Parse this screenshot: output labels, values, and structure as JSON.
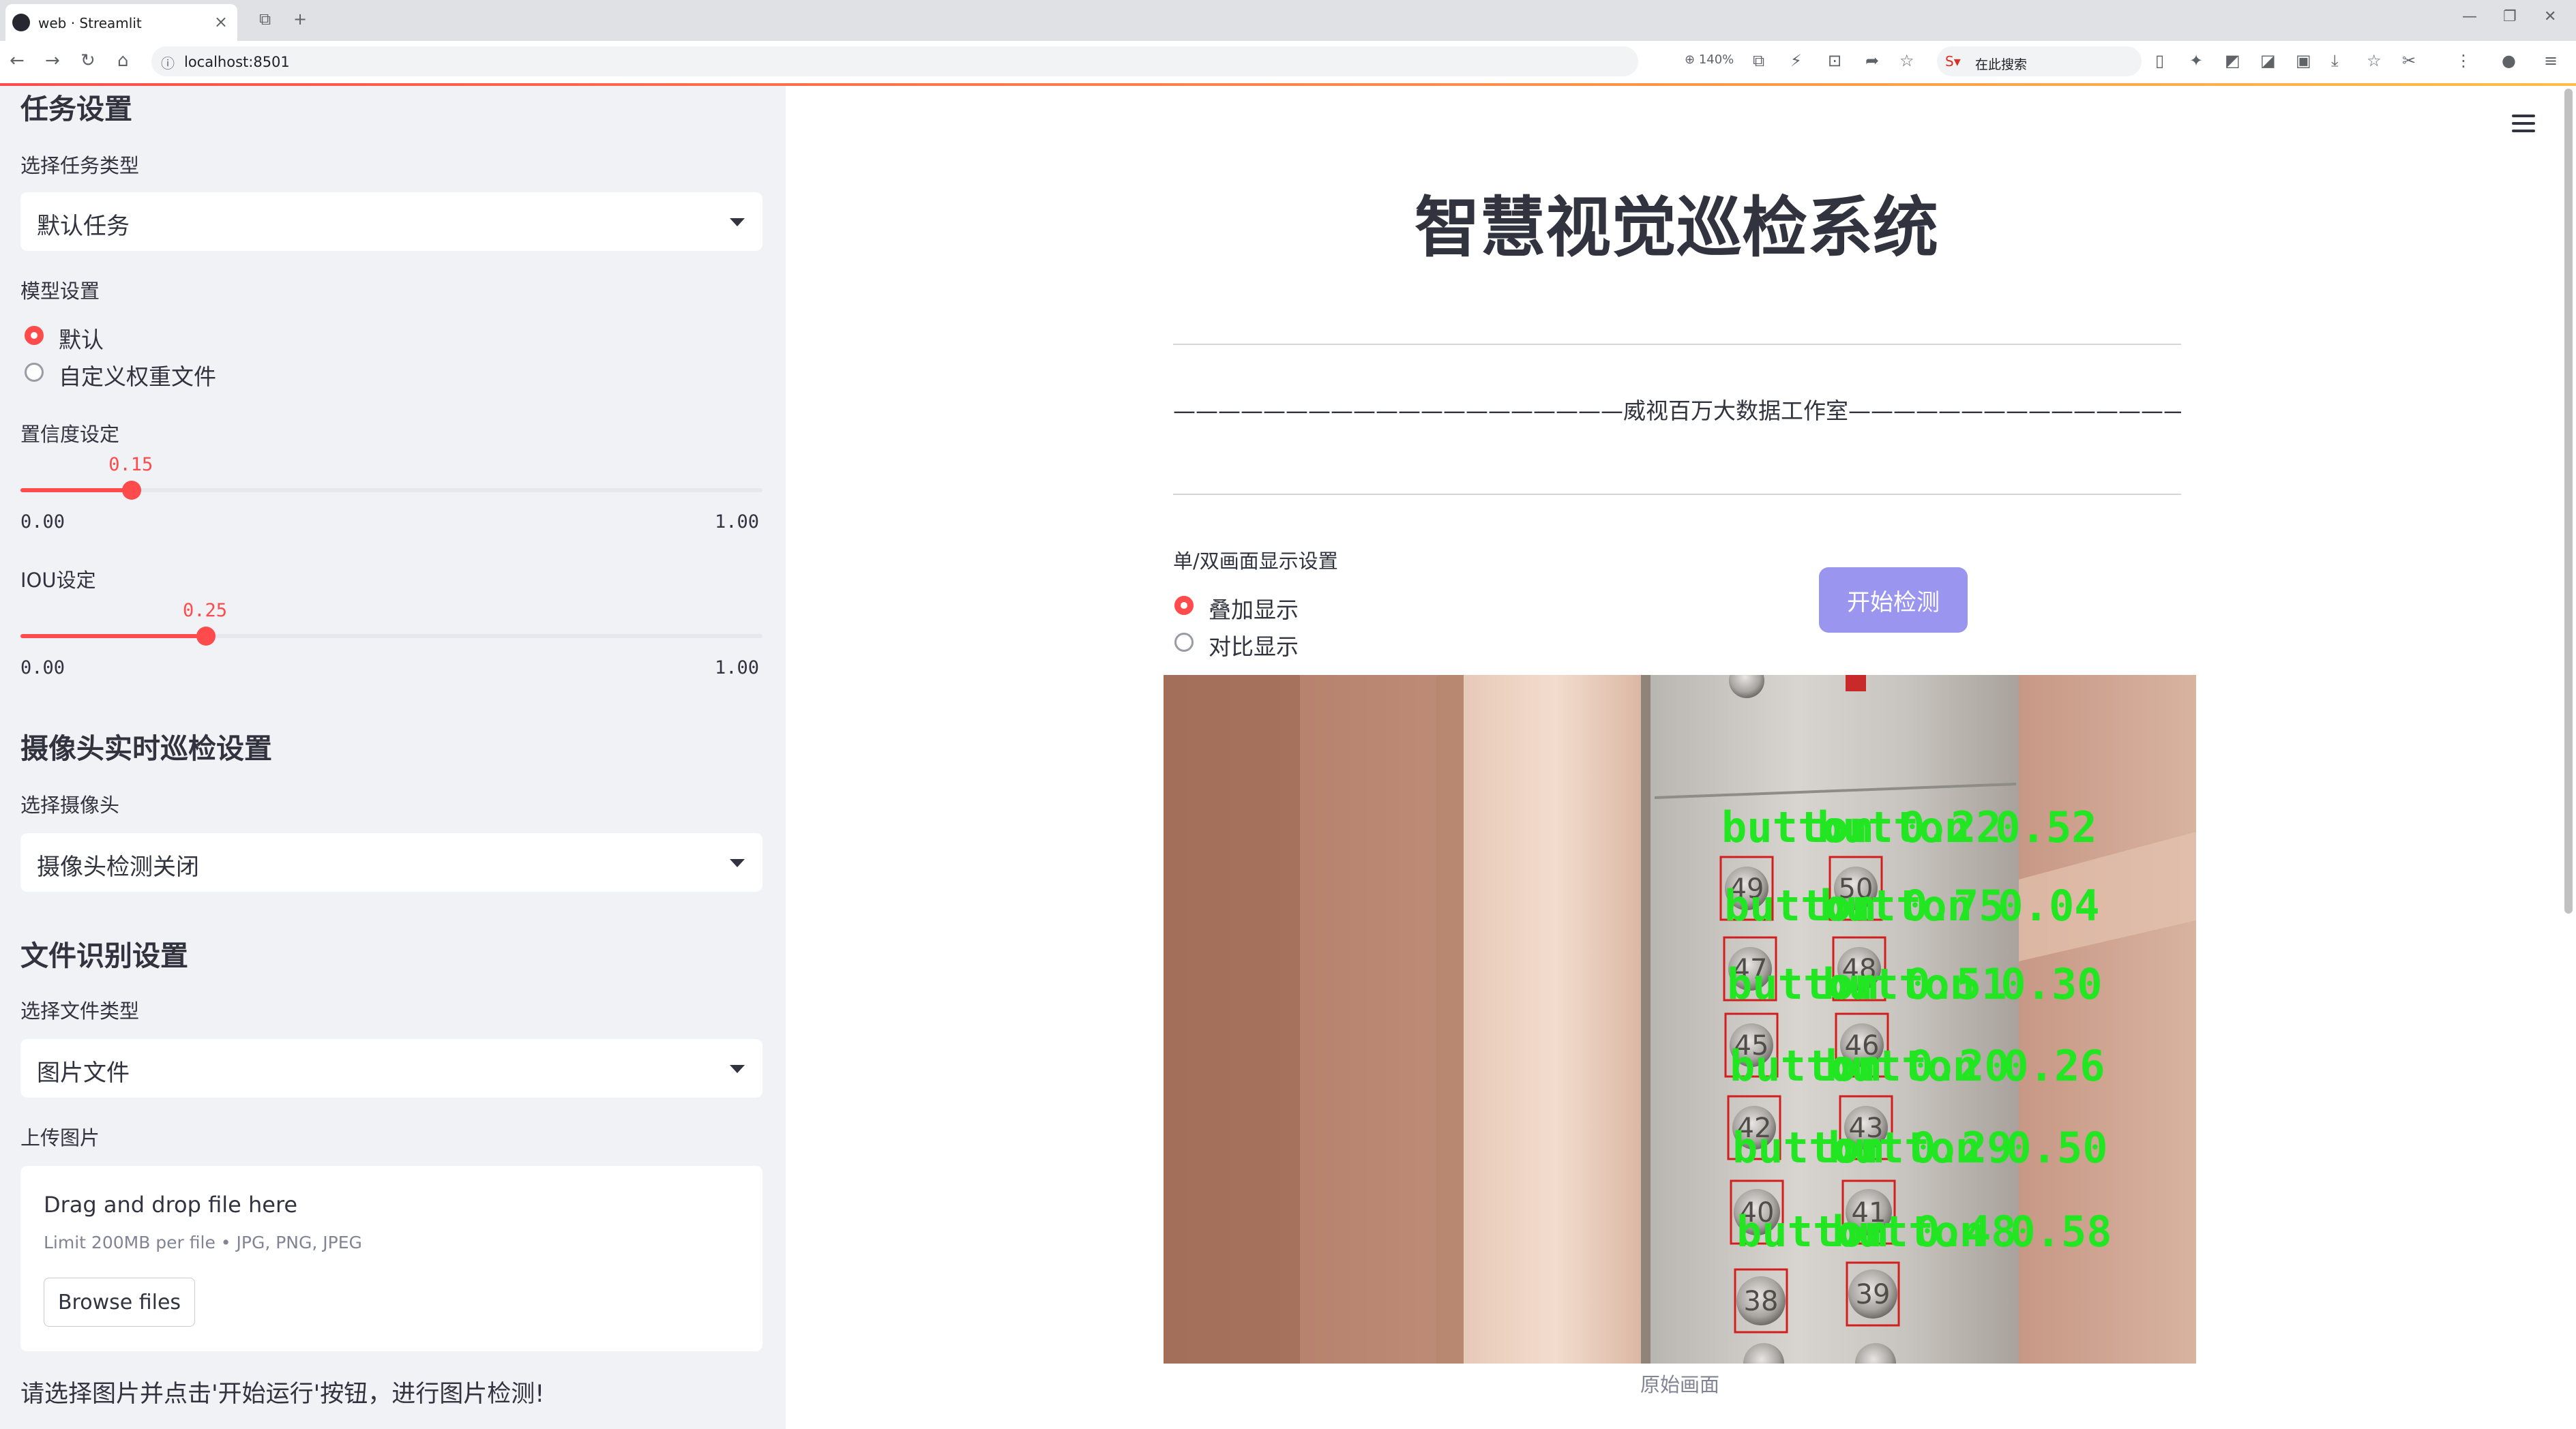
{
  "browser": {
    "tab_title": "web · Streamlit",
    "url": "localhost:8501",
    "zoom": "140%",
    "search_placeholder": "在此搜索"
  },
  "sidebar": {
    "task_section": {
      "heading": "任务设置",
      "select_label": "选择任务类型",
      "select_value": "默认任务"
    },
    "model_section": {
      "label": "模型设置",
      "options": [
        "默认",
        "自定义权重文件"
      ],
      "selected": "默认"
    },
    "confidence": {
      "label": "置信度设定",
      "value": "0.15",
      "fraction": 0.15,
      "min": "0.00",
      "max": "1.00"
    },
    "iou": {
      "label": "IOU设定",
      "value": "0.25",
      "fraction": 0.25,
      "min": "0.00",
      "max": "1.00"
    },
    "camera_section": {
      "heading": "摄像头实时巡检设置",
      "select_label": "选择摄像头",
      "select_value": "摄像头检测关闭"
    },
    "file_section": {
      "heading": "文件识别设置",
      "select_label": "选择文件类型",
      "select_value": "图片文件",
      "upload_label": "上传图片",
      "drag_text": "Drag and drop file here",
      "limit_text": "Limit 200MB per file • JPG, PNG, JPEG",
      "browse_label": "Browse files"
    },
    "note": "请选择图片并点击'开始运行'按钮，进行图片检测!"
  },
  "main": {
    "title": "智慧视觉巡检系统",
    "studio_line": "————————————————————威视百万大数据工作室—————————————————————",
    "display_label": "单/双画面显示设置",
    "display_options": [
      "叠加显示",
      "对比显示"
    ],
    "display_selected": "叠加显示",
    "start_button": "开始检测",
    "image_caption": "原始画面",
    "detections": [
      {
        "text": "button  0.22"
      },
      {
        "text": "button  0.52"
      },
      {
        "text": "button  0.75"
      },
      {
        "text": "button  0.04"
      },
      {
        "text": "button  0.51"
      },
      {
        "text": "button  0.30"
      },
      {
        "text": "button  0.20"
      },
      {
        "text": "button  0.26"
      },
      {
        "text": "button  0.29"
      },
      {
        "text": "button  0.50"
      },
      {
        "text": "button  0.48"
      },
      {
        "text": "button  0.58"
      }
    ],
    "panel_numbers": [
      "49",
      "50",
      "47",
      "48",
      "45",
      "46",
      "42",
      "43",
      "40",
      "41",
      "38",
      "39"
    ]
  },
  "colors": {
    "accent": "#ff4b4b",
    "start_button": "#9a95ef",
    "sidebar_bg": "#f0f2f6",
    "detection_text": "#22e622",
    "detection_box": "#d21e1e"
  }
}
